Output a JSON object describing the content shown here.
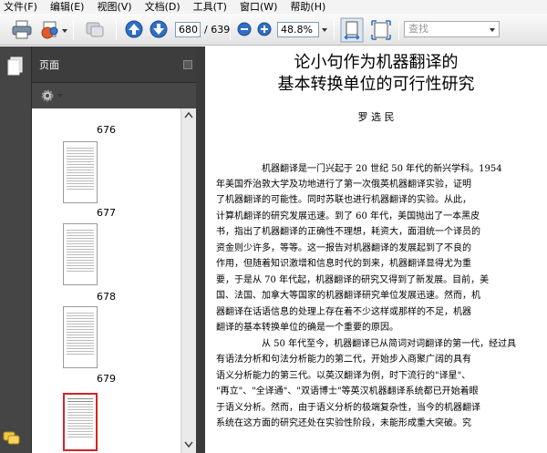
{
  "menu": [
    "文件(F)",
    "编辑(E)",
    "视图(V)",
    "文档(D)",
    "工具(T)",
    "窗口(W)",
    "帮助(H)"
  ],
  "toolbar": {
    "page_current": "680",
    "page_total": "/ 639",
    "zoom": "48.8%",
    "search_placeholder": "查找"
  },
  "panel": {
    "title": "页面",
    "thumbnails": [
      {
        "label": "676"
      },
      {
        "label": "677"
      },
      {
        "label": "678"
      },
      {
        "label": "679"
      }
    ],
    "selected_page": "680"
  },
  "document": {
    "title_lines": [
      "论小句作为机器翻译的",
      "基本转换单位的可行性研究"
    ],
    "author": "罗 选 民",
    "lines": [
      {
        "text": "机器翻译是一门兴起于 20 世纪 50 年代的新兴学科。1954",
        "indent": true
      },
      {
        "text": "年美国乔治敦大学及功地进行了第一次俄英机器翻译实验，证明",
        "indent": false
      },
      {
        "text": "了机器翻译的可能性。同时苏联也进行机器翻译的实验。从此，",
        "indent": false
      },
      {
        "text": "计算机翻译的研究发展迅速。到了 60 年代，美国抛出了一本黑皮",
        "indent": false
      },
      {
        "text": "书，指出了机器翻译的正确性不理想，耗资大，面泪统一个译员的",
        "indent": false
      },
      {
        "text": "资金则少许多，等等。这一报告对机器翻译的发展起到了不良的",
        "indent": false
      },
      {
        "text": "作用，但随着知识激增和信息时代的到来，机器翻译显得尤为重",
        "indent": false
      },
      {
        "text": "要，于是从 70 年代起，机器翻译的研究又得到了新发展。目前，美",
        "indent": false
      },
      {
        "text": "国、法国、加拿大等国家的机器翻译研究单位发展迅速。然而，机",
        "indent": false
      },
      {
        "text": "器翻译在话语信息的处理上存在着不少这样或那样的不足，机器",
        "indent": false
      },
      {
        "text": "翻译的基本转换单位的确是一个重要的原因。",
        "indent": false
      },
      {
        "text": "从 50 年代至今，机器翻译已从简词对词翻译的第一代，经过具",
        "indent": true
      },
      {
        "text": "有语法分析和句法分析能力的第二代，开始步入商聚广阔的具有",
        "indent": false
      },
      {
        "text": "语义分析能力的第三代。以英汉翻译为例，时下流行的\"译星\"、",
        "indent": false
      },
      {
        "text": "\"再立\"、\"全译通\"、\"双语博士\"等英汉机器翻译系统都已开始着眼",
        "indent": false
      },
      {
        "text": "于语义分析。然而，由于语义分析的极端复杂性，当今的机器翻译",
        "indent": false
      },
      {
        "text": "系统在这方面的研究还处在实验性阶段，未能形成重大突破。究",
        "indent": false
      }
    ]
  },
  "colors": {
    "panel_dark": "#3d3d3d",
    "selection": "#d12424",
    "icon_blue": "#2f6fc4"
  }
}
